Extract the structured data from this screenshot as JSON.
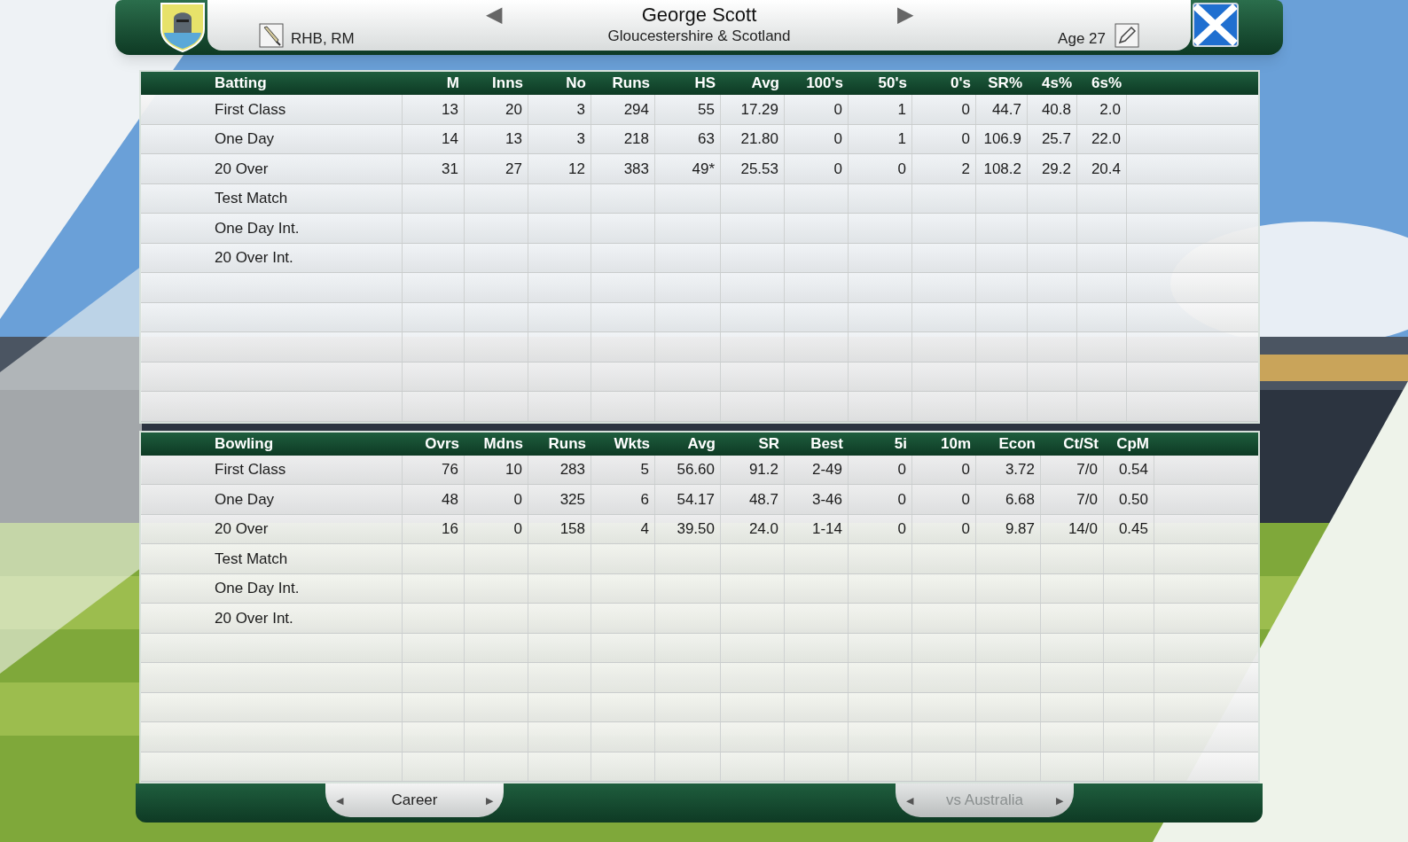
{
  "player": {
    "name": "George Scott",
    "teams": "Gloucestershire & Scotland",
    "style": "RHB, RM",
    "age": "Age 27"
  },
  "nav": {
    "previous": "◀",
    "next": "▶"
  },
  "batting": {
    "columns": [
      "Batting",
      "M",
      "Inns",
      "No",
      "Runs",
      "HS",
      "Avg",
      "100's",
      "50's",
      "0's",
      "SR%",
      "4s%",
      "6s%"
    ],
    "rows": [
      {
        "label": "First Class",
        "values": [
          "13",
          "20",
          "3",
          "294",
          "55",
          "17.29",
          "0",
          "1",
          "0",
          "44.7",
          "40.8",
          "2.0"
        ]
      },
      {
        "label": "One Day",
        "values": [
          "14",
          "13",
          "3",
          "218",
          "63",
          "21.80",
          "0",
          "1",
          "0",
          "106.9",
          "25.7",
          "22.0"
        ]
      },
      {
        "label": "20 Over",
        "values": [
          "31",
          "27",
          "12",
          "383",
          "49*",
          "25.53",
          "0",
          "0",
          "2",
          "108.2",
          "29.2",
          "20.4"
        ]
      },
      {
        "label": "Test Match"
      },
      {
        "label": "One Day Int."
      },
      {
        "label": "20 Over Int."
      }
    ]
  },
  "bowling": {
    "columns": [
      "Bowling",
      "Ovrs",
      "Mdns",
      "Runs",
      "Wkts",
      "Avg",
      "SR",
      "Best",
      "5i",
      "10m",
      "Econ",
      "Ct/St",
      "CpM"
    ],
    "rows": [
      {
        "label": "First Class",
        "values": [
          "76",
          "10",
          "283",
          "5",
          "56.60",
          "91.2",
          "2-49",
          "0",
          "0",
          "3.72",
          "7/0",
          "0.54"
        ]
      },
      {
        "label": "One Day",
        "values": [
          "48",
          "0",
          "325",
          "6",
          "54.17",
          "48.7",
          "3-46",
          "0",
          "0",
          "6.68",
          "7/0",
          "0.50"
        ]
      },
      {
        "label": "20 Over",
        "values": [
          "16",
          "0",
          "158",
          "4",
          "39.50",
          "24.0",
          "1-14",
          "0",
          "0",
          "9.87",
          "14/0",
          "0.45"
        ]
      },
      {
        "label": "Test Match"
      },
      {
        "label": "One Day Int."
      },
      {
        "label": "20 Over Int."
      }
    ]
  },
  "tabs": [
    {
      "label": "Career",
      "disabled": false,
      "left": "◀",
      "right": "▶"
    },
    {
      "label": "vs Australia",
      "disabled": true,
      "left": "◀",
      "right": "▶"
    }
  ]
}
